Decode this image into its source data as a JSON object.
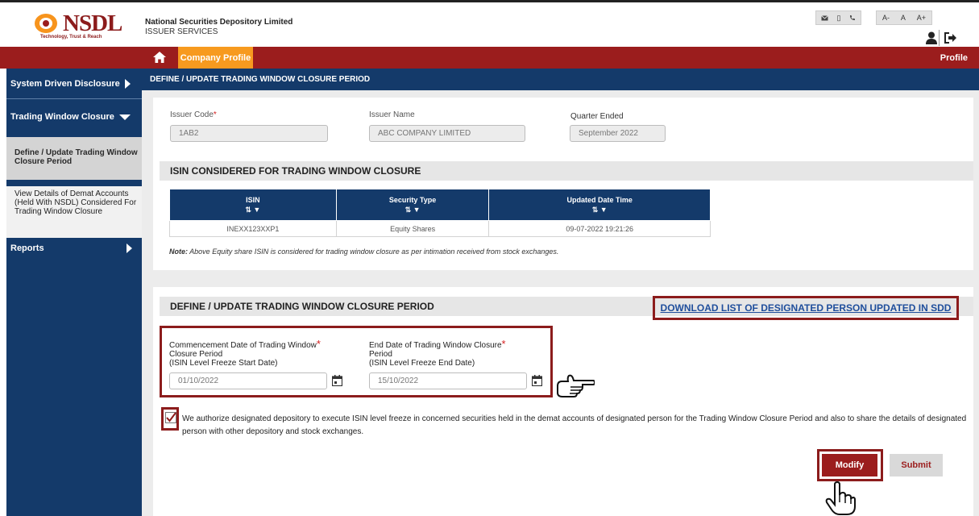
{
  "header": {
    "logo_text": "NSDL",
    "logo_tagline": "Technology, Trust & Reach",
    "org_name": "National Securities Depository Limited",
    "org_sub": "ISSUER SERVICES",
    "font_tools": [
      "A-",
      "A",
      "A+"
    ],
    "contact_icons": [
      "mail-icon",
      "phone-icon"
    ]
  },
  "nav": {
    "home_icon": "home-icon",
    "active_tab": "Company Profile",
    "profile": "Profile"
  },
  "sidebar": {
    "items": [
      {
        "label": "System Driven Disclosure"
      },
      {
        "label": "Trading Window Closure"
      },
      {
        "label": "Reports"
      }
    ],
    "subitems": [
      {
        "label": "Define / Update Trading Window Closure Period",
        "active": true
      },
      {
        "label": "View Details of Demat Accounts (Held With NSDL) Considered For Trading Window Closure",
        "active": false
      }
    ]
  },
  "page_title": "DEFINE / UPDATE TRADING WINDOW CLOSURE PERIOD",
  "issuer": {
    "code_label": "Issuer Code",
    "code_value": "1AB2",
    "name_label": "Issuer Name",
    "name_value": "ABC COMPANY LIMITED",
    "quarter_label": "Quarter Ended",
    "quarter_value": "September 2022"
  },
  "isin_section": {
    "title": "ISIN CONSIDERED FOR TRADING WINDOW CLOSURE",
    "columns": [
      "ISIN",
      "Security Type",
      "Updated Date Time"
    ],
    "rows": [
      [
        "INEXX123XXP1",
        "Equity Shares",
        "09-07-2022 19:21:26"
      ]
    ],
    "note_bold": "Note:",
    "note_text": "Above Equity share ISIN is considered for trading window closure as per intimation received from stock exchanges."
  },
  "define_section": {
    "title": "DEFINE / UPDATE TRADING WINDOW CLOSURE PERIOD",
    "download_link": "DOWNLOAD LIST OF DESIGNATED PERSON UPDATED IN SDD",
    "start_label_1": "Commencement Date of Trading Window",
    "start_label_2": "Closure Period",
    "start_label_3": "(ISIN Level Freeze Start Date)",
    "start_value": "01/10/2022",
    "end_label_1": "End Date of Trading Window Closure",
    "end_label_2": "Period",
    "end_label_3": "(ISIN Level Freeze End Date)",
    "end_value": "15/10/2022",
    "auth_text": "We authorize designated depository to execute ISIN level freeze in concerned securities held in the demat accounts of designated person for the Trading Window Closure Period and also to share the details of designated person with other depository and stock exchanges.",
    "auth_checked": true,
    "modify_label": "Modify",
    "submit_label": "Submit"
  },
  "colors": {
    "brand_red": "#9b1d1d",
    "navy": "#143a6a",
    "orange_tab": "#f79a1f",
    "highlight_box": "#8c1c1c",
    "link_blue": "#1f4e9c"
  }
}
